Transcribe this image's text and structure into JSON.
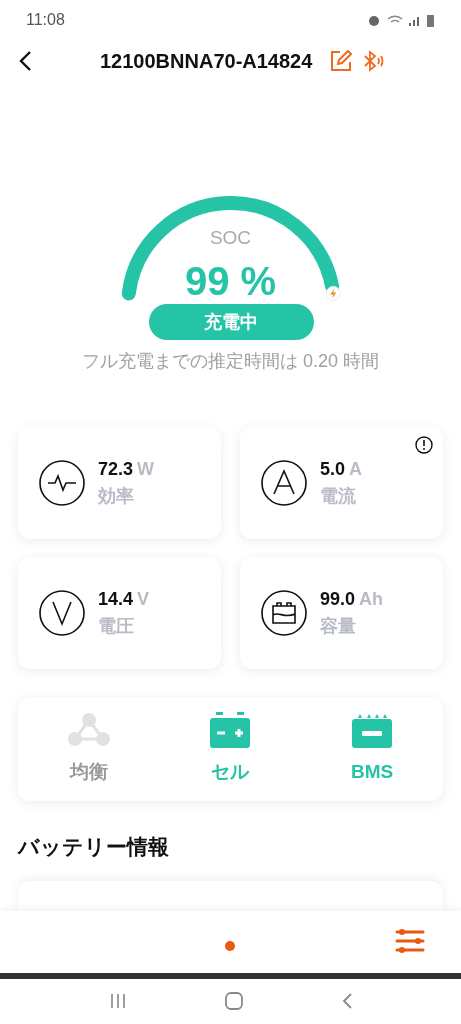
{
  "status_bar": {
    "time": "11:08"
  },
  "header": {
    "title": "12100BNNA70-A14824"
  },
  "soc": {
    "label": "SOC",
    "value": "99 %",
    "status": "充電中",
    "estimate": "フル充電までの推定時間は 0.20 時間"
  },
  "metrics": [
    {
      "kind": "pulse",
      "value": "72.3",
      "unit": "W",
      "label": "効率",
      "alert": false
    },
    {
      "kind": "ampere",
      "value": "5.0",
      "unit": "A",
      "label": "電流",
      "alert": true
    },
    {
      "kind": "volt",
      "value": "14.4",
      "unit": "V",
      "label": "電圧",
      "alert": false
    },
    {
      "kind": "battery",
      "value": "99.0",
      "unit": "Ah",
      "label": "容量",
      "alert": false
    }
  ],
  "functions": [
    {
      "kind": "balance",
      "label": "均衡",
      "enabled": false
    },
    {
      "kind": "cell",
      "label": "セル",
      "enabled": true
    },
    {
      "kind": "bms",
      "label": "BMS",
      "enabled": true
    }
  ],
  "section_title": "バッテリー情報"
}
